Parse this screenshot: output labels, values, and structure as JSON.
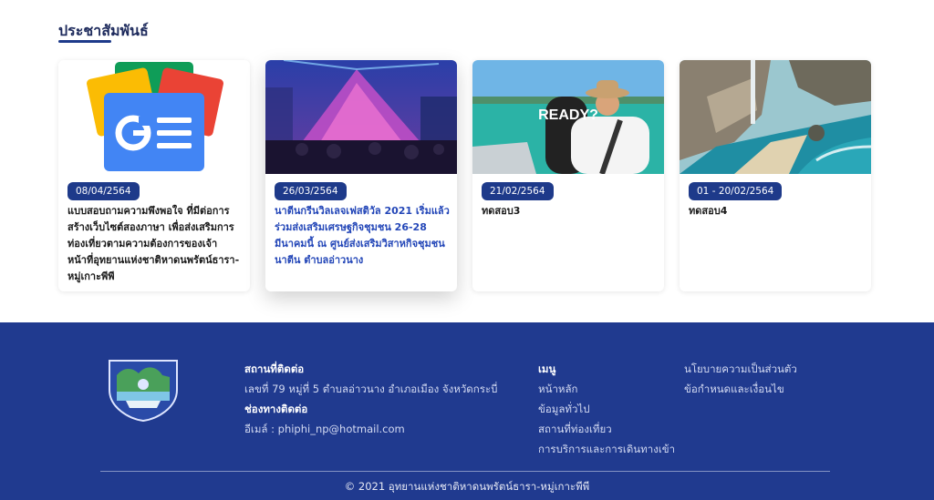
{
  "section": {
    "title": "ประชาสัมพันธ์"
  },
  "cards": [
    {
      "date": "08/04/2564",
      "title": "แบบสอบถามความพึงพอใจ ที่มีต่อการสร้างเว็บไซต์สองภาษา เพื่อส่งเสริมการท่องเที่ยวตามความต้องการของเจ้าหน้าที่อุทยานแห่งชาติหาดนพรัตน์ธารา-หมู่เกาะพีพี"
    },
    {
      "date": "26/03/2564",
      "title": "นาตีนกรีนวิลเลจเฟสติวัล 2021 เริ่มแล้ว ร่วมส่งเสริมเศรษฐกิจชุมชน 26-28 มีนาคมนี้ ณ ศูนย์ส่งเสริมวิสาหกิจชุมชนนาตีน ตำบลอ่าวนาง"
    },
    {
      "date": "21/02/2564",
      "title": "ทดสอบ3",
      "image_text": "READY?"
    },
    {
      "date": "01 - 20/02/2564",
      "title": "ทดสอบ4"
    }
  ],
  "footer": {
    "contact": {
      "heading": "สถานที่ติดต่อ",
      "address": "เลขที่ 79 หมู่ที่ 5 ตำบลอ่าวนาง อำเภอเมือง จังหวัดกระบี่",
      "channel_heading": "ช่องทางติดต่อ",
      "email": "อีเมล์ : phiphi_np@hotmail.com"
    },
    "menu": {
      "heading": "เมนู",
      "items": [
        "หน้าหลัก",
        "ข้อมูลทั่วไป",
        "สถานที่ท่องเที่ยว",
        "การบริการและการเดินทางเข้า"
      ]
    },
    "policy": {
      "items": [
        "นโยบายความเป็นส่วนตัว",
        "ข้อกำหนดและเงื่อนไข"
      ]
    },
    "copyright": "© 2021 อุทยานแห่งชาติหาดนพรัตน์ธารา-หมู่เกาะพีพี"
  },
  "colors": {
    "brand_navy": "#1e3a8a",
    "footer_bg": "#203a8f",
    "link_blue": "#2447b8"
  }
}
